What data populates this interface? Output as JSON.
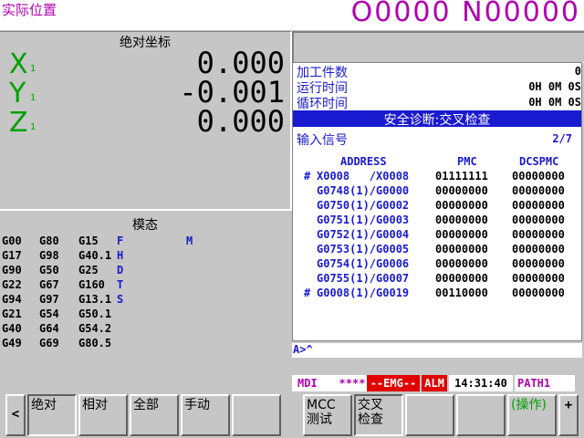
{
  "header": {
    "screen_title": "实际位置",
    "program_number": "O0000 N00000"
  },
  "position": {
    "title": "绝对坐标",
    "axes": [
      {
        "name": "X",
        "sub": "1",
        "value": "0.000"
      },
      {
        "name": "Y",
        "sub": "1",
        "value": "-0.001"
      },
      {
        "name": "Z",
        "sub": "1",
        "value": "0.000"
      }
    ]
  },
  "modal": {
    "title": "模态",
    "rows": [
      [
        "G00",
        "G80",
        "G15"
      ],
      [
        "G17",
        "G98",
        "G40.1"
      ],
      [
        "G90",
        "G50",
        "G25"
      ],
      [
        "G22",
        "G67",
        "G160"
      ],
      [
        "G94",
        "G97",
        "G13.1"
      ],
      [
        "G21",
        "G54",
        "G50.1"
      ],
      [
        "G40",
        "G64",
        "G54.2"
      ],
      [
        "G49",
        "G69",
        "G80.5"
      ]
    ],
    "letters": [
      "F",
      "H",
      "D",
      "T",
      "S"
    ],
    "m_label": "M"
  },
  "info": {
    "parts_label": "加工件数",
    "parts_value": "0",
    "run_time_label": "运行时间",
    "run_time_value": "0H 0M 0S",
    "cycle_time_label": "循环时间",
    "cycle_time_value": "0H 0M 0S"
  },
  "diagnosis": {
    "title": "安全诊断:交叉检查",
    "section": "输入信号",
    "page": "2/7",
    "headers": [
      "ADDRESS",
      "PMC",
      "DCSPMC"
    ],
    "rows": [
      {
        "mark": "#",
        "address": "X0008   /X0008",
        "pmc": "01111111",
        "dcspmc": "00000000"
      },
      {
        "mark": "",
        "address": "G0748(1)/G0000",
        "pmc": "00000000",
        "dcspmc": "00000000"
      },
      {
        "mark": "",
        "address": "G0750(1)/G0002",
        "pmc": "00000000",
        "dcspmc": "00000000"
      },
      {
        "mark": "",
        "address": "G0751(1)/G0003",
        "pmc": "00000000",
        "dcspmc": "00000000"
      },
      {
        "mark": "",
        "address": "G0752(1)/G0004",
        "pmc": "00000000",
        "dcspmc": "00000000"
      },
      {
        "mark": "",
        "address": "G0753(1)/G0005",
        "pmc": "00000000",
        "dcspmc": "00000000"
      },
      {
        "mark": "",
        "address": "G0754(1)/G0006",
        "pmc": "00000000",
        "dcspmc": "00000000"
      },
      {
        "mark": "",
        "address": "G0755(1)/G0007",
        "pmc": "00000000",
        "dcspmc": "00000000"
      },
      {
        "mark": "#",
        "address": "G0008(1)/G0019",
        "pmc": "00110000",
        "dcspmc": "00000000"
      }
    ]
  },
  "input_line": {
    "prompt": "A>^"
  },
  "status": {
    "mode": "MDI",
    "stars": "****",
    "emg": "--EMG--",
    "alm": "ALM",
    "time": "14:31:40",
    "path": "PATH1"
  },
  "softkeys": {
    "left_arrow": "<",
    "absolute": "绝对",
    "relative": "相对",
    "all": "全部",
    "manual": "手动",
    "mcc_test": "MCC 测试",
    "cross_check": "交叉检查",
    "operation": "(操作)",
    "plus": "+"
  },
  "colors": {
    "background": "#c6c6c6",
    "magenta": "#b000b0",
    "green_axis": "#00a000",
    "blue": "#1a1ad0",
    "emg_red": "#e00000",
    "status_green": "#00a000"
  }
}
